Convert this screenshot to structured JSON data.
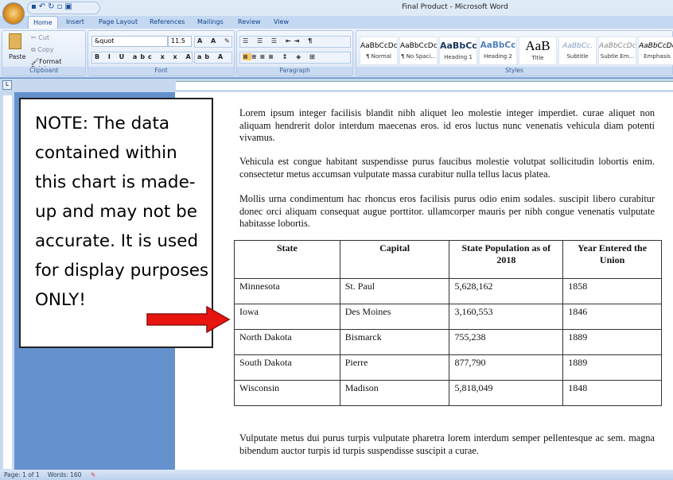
{
  "window": {
    "title": "Final Product - Microsoft Word"
  },
  "ribbon": {
    "tabs": [
      "Home",
      "Insert",
      "Page Layout",
      "References",
      "Mailings",
      "Review",
      "View"
    ],
    "clipboard": {
      "paste": "Paste",
      "cut": "Cut",
      "copy": "Copy",
      "format_painter": "Format Painter",
      "label": "Clipboard"
    },
    "font": {
      "name": "&quot",
      "size": "11.5",
      "label": "Font"
    },
    "paragraph": {
      "label": "Paragraph"
    },
    "styles": {
      "label": "Styles",
      "items": [
        {
          "preview": "AaBbCcDc",
          "name": "¶ Normal"
        },
        {
          "preview": "AaBbCcDc",
          "name": "¶ No Spaci..."
        },
        {
          "preview": "AaBbCc",
          "name": "Heading 1"
        },
        {
          "preview": "AaBbCc",
          "name": "Heading 2"
        },
        {
          "preview": "AaB",
          "name": "Title"
        },
        {
          "preview": "AaBbCc.",
          "name": "Subtitle"
        },
        {
          "preview": "AaBbCcDc",
          "name": "Subtle Em..."
        },
        {
          "preview": "AaBbCcDc",
          "name": "Emphasis"
        }
      ]
    }
  },
  "document": {
    "paragraphs": [
      "Lorem ipsum integer facilisis blandit nibh aliquet leo molestie integer imperdiet. curae aliquet non aliquam hendrerit dolor interdum maecenas eros. id eros luctus nunc venenatis vehicula diam potenti vivamus.",
      "Vehicula est congue habitant suspendisse purus faucibus molestie volutpat sollicitudin lobortis enim. consectetur metus accumsan vulputate massa curabitur nulla tellus lacus platea.",
      "Mollis urna condimentum hac rhoncus eros facilisis purus odio enim sodales. suscipit libero curabitur donec orci aliquam consequat augue porttitor. ullamcorper mauris per nibh congue venenatis vulputate habitasse lobortis.",
      "Vulputate metus dui purus turpis vulputate pharetra lorem interdum semper pellentesque ac sem. magna bibendum auctor turpis id turpis suspendisse suscipit a curae."
    ],
    "table": {
      "headers": [
        "State",
        "Capital",
        "State Population as of 2018",
        "Year Entered the Union"
      ],
      "rows": [
        [
          "Minnesota",
          "St. Paul",
          "5,628,162",
          "1858"
        ],
        [
          "Iowa",
          "Des Moines",
          "3,160,553",
          "1846"
        ],
        [
          "North Dakota",
          "Bismarck",
          "755,238",
          "1889"
        ],
        [
          "South Dakota",
          "Pierre",
          "877,790",
          "1889"
        ],
        [
          "Wisconsin",
          "Madison",
          "5,818,049",
          "1848"
        ]
      ]
    }
  },
  "note": {
    "text": "NOTE: The data contained within this chart is made-up and may not be accurate. It is used for display purposes ONLY!"
  },
  "colors": {
    "arrow": "#e8150f",
    "background": "#6591cd"
  },
  "status": {
    "page": "Page: 1 of 1",
    "words": "Words: 160"
  }
}
